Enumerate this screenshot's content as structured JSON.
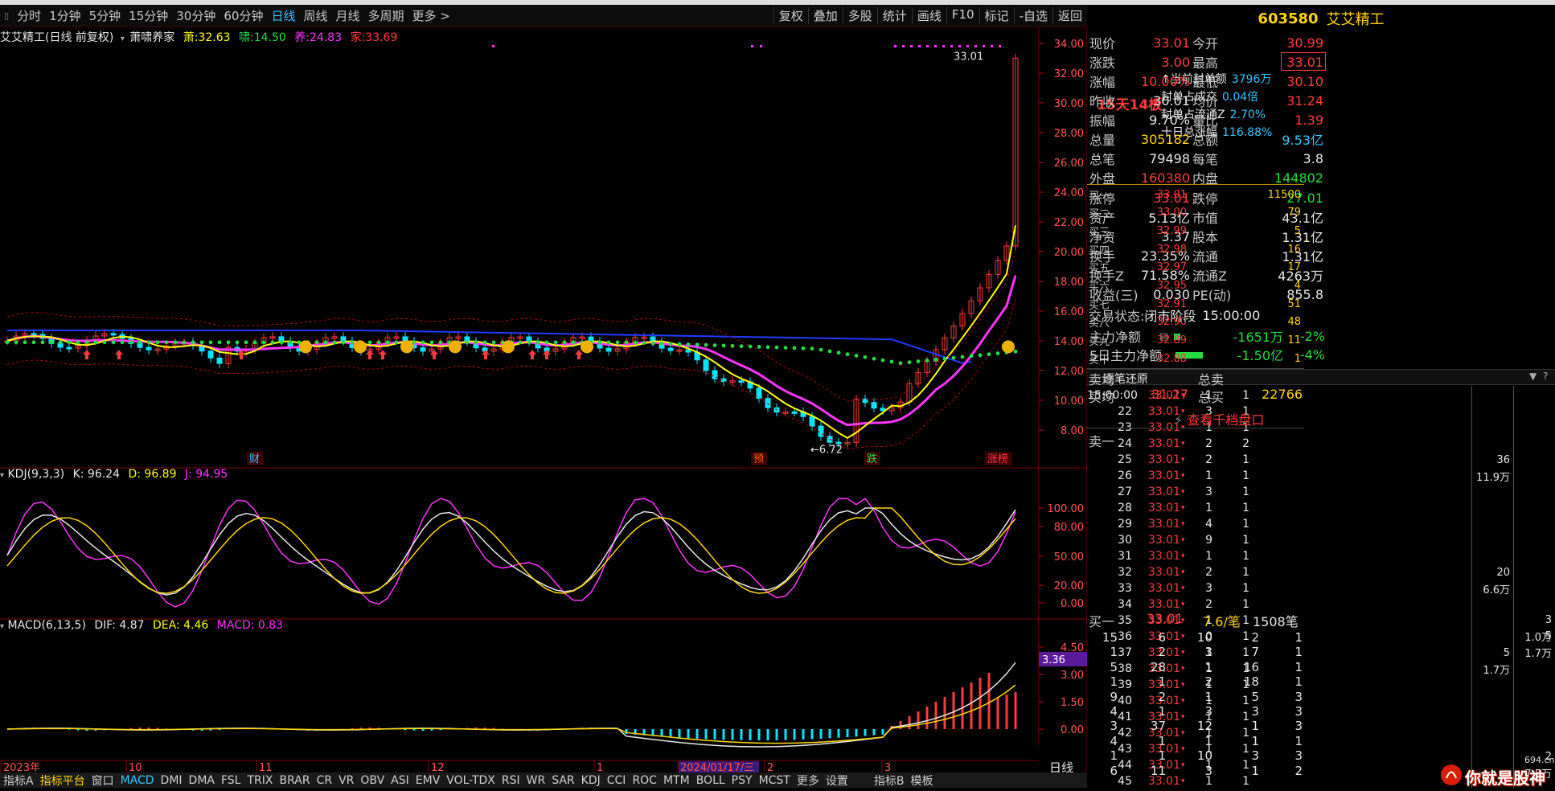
{
  "toolbar": {
    "periods": [
      "分时",
      "1分钟",
      "5分钟",
      "15分钟",
      "30分钟",
      "60分钟",
      "日线",
      "周线",
      "月线",
      "多周期",
      "更多 >"
    ],
    "active": "日线",
    "right": [
      "复权",
      "叠加",
      "多股",
      "统计",
      "画线",
      "F10",
      "标记",
      "-自选",
      "返回"
    ]
  },
  "chart": {
    "title": "艾艾精工(日线 前复权)",
    "indicator": "萧啸养家",
    "line1_label": "萧:",
    "line1_value": "32.63",
    "line2_label": "啸:",
    "line2_value": "14.50",
    "line3_label": "养:",
    "line3_value": "24.83",
    "line4_label": "家:",
    "line4_value": "33.69",
    "price_ticks": [
      "34.00",
      "32.00",
      "30.00",
      "28.00",
      "26.00",
      "24.00",
      "22.00",
      "20.00",
      "18.00",
      "16.00",
      "14.00",
      "12.00",
      "10.00",
      "8.00"
    ],
    "high_label": "33.01",
    "low_label": "6.72",
    "markers": [
      "财",
      "预",
      "跌",
      "涨榜"
    ],
    "kdj_title": "KDJ(9,3,3)",
    "kdj_k": "K: 96.24",
    "kdj_d": "D: 96.89",
    "kdj_j": "J: 94.95",
    "kdj_ticks": [
      "100.00",
      "80.00",
      "50.00",
      "20.00",
      "0.00"
    ],
    "macd_title": "MACD(6,13,5)",
    "macd_dif": "DIF: 4.87",
    "macd_dea": "DEA: 4.46",
    "macd_val": "MACD: 0.83",
    "macd_ticks": [
      "4.50",
      "3.00",
      "1.50",
      "0.00"
    ],
    "macd_cursor": "3.36",
    "date_labels": [
      "2023年",
      "10",
      "11",
      "12",
      "1",
      "2024/01/17/三",
      "2",
      "3"
    ],
    "period_label": "日线",
    "seal_info": {
      "streak": "15天14板",
      "rows": [
        {
          "k": "↑当前封单额",
          "v": "3796万"
        },
        {
          "k": "封单占成交",
          "v": "0.04倍"
        },
        {
          "k": "封单占流通Z",
          "v": "2.70%"
        },
        {
          "k": "十日总涨幅",
          "v": "116.88%"
        }
      ]
    }
  },
  "tabs": [
    "指标A",
    "指标平台",
    "窗口",
    "MACD",
    "DMI",
    "DMA",
    "FSL",
    "TRIX",
    "BRAR",
    "CR",
    "VR",
    "OBV",
    "ASI",
    "EMV",
    "VOL-TDX",
    "RSI",
    "WR",
    "SAR",
    "KDJ",
    "CCI",
    "ROC",
    "MTM",
    "BOLL",
    "PSY",
    "MCST",
    "更多",
    "设置",
    "指标B",
    "模板"
  ],
  "stock": {
    "code": "603580",
    "name": "艾艾精工"
  },
  "quote": [
    {
      "l1": "现价",
      "v1": "33.01",
      "c1": "red",
      "l2": "今开",
      "v2": "30.99",
      "c2": "red"
    },
    {
      "l1": "涨跌",
      "v1": "3.00",
      "c1": "red",
      "l2": "最高",
      "v2": "33.01",
      "c2": "red"
    },
    {
      "l1": "涨幅",
      "v1": "10.00%",
      "c1": "red",
      "l2": "最低",
      "v2": "30.10",
      "c2": "red"
    },
    {
      "l1": "昨收",
      "v1": "30.01",
      "c1": "wht",
      "l2": "均价",
      "v2": "31.24",
      "c2": "red"
    },
    {
      "l1": "振幅",
      "v1": "9.70%",
      "c1": "wht",
      "l2": "量比",
      "v2": "1.39",
      "c2": "red"
    },
    {
      "l1": "总量",
      "v1": "305182",
      "c1": "yel",
      "l2": "总额",
      "v2": "9.53亿",
      "c2": "cy"
    },
    {
      "l1": "总笔",
      "v1": "79498",
      "c1": "wht",
      "l2": "每笔",
      "v2": "3.8",
      "c2": "wht"
    },
    {
      "l1": "外盘",
      "v1": "160380",
      "c1": "red",
      "l2": "内盘",
      "v2": "144802",
      "c2": "grn"
    }
  ],
  "limits": [
    {
      "l1": "涨停",
      "v1": "33.01",
      "c1": "red",
      "l2": "跌停",
      "v2": "27.01",
      "c2": "grn"
    },
    {
      "l1": "资产",
      "v1": "5.13亿",
      "c1": "wht",
      "l2": "市值",
      "v2": "43.1亿",
      "c2": "wht"
    },
    {
      "l1": "净资",
      "v1": "3.37",
      "c1": "wht",
      "l2": "股本",
      "v2": "1.31亿",
      "c2": "wht"
    },
    {
      "l1": "换手",
      "v1": "23.35%",
      "c1": "wht",
      "l2": "流通",
      "v2": "1.31亿",
      "c2": "wht"
    },
    {
      "l1": "换手Z",
      "v1": "71.58%",
      "c1": "wht",
      "l2": "流通Z",
      "v2": "4263万",
      "c2": "wht"
    },
    {
      "l1": "收益(三)",
      "v1": "0.030",
      "c1": "wht",
      "l2": "PE(动)",
      "v2": "855.8",
      "c2": "wht"
    }
  ],
  "trade_status": {
    "label": "交易状态:",
    "phase": "闭市阶段",
    "time": "15:00:00"
  },
  "flows": [
    {
      "label": "主力净额",
      "value": "-1651万",
      "pct": "-2%"
    },
    {
      "label": "5日主力净额",
      "value": "-1.50亿",
      "pct": "-4%"
    }
  ],
  "bids": [
    {
      "l": "买一",
      "p": "33.01",
      "v": "11500"
    },
    {
      "l": "买二",
      "p": "33.00",
      "v": "79"
    },
    {
      "l": "买三",
      "p": "32.99",
      "v": "5"
    },
    {
      "l": "买四",
      "p": "32.98",
      "v": "16"
    },
    {
      "l": "买五",
      "p": "32.97",
      "v": "17"
    },
    {
      "l": "买六",
      "p": "32.95",
      "v": "4"
    },
    {
      "l": "买七",
      "p": "32.91",
      "v": "51"
    },
    {
      "l": "买八",
      "p": "32.90",
      "v": "48"
    },
    {
      "l": "买九",
      "p": "32.89",
      "v": "11"
    },
    {
      "l": "买十",
      "p": "32.88",
      "v": "1"
    }
  ],
  "avg": {
    "sell_avg": "卖均",
    "sell_total": "总卖",
    "buy_avg": "买均",
    "buy_avg_v": "31.27",
    "buy_total": "总买",
    "buy_total_v": "22766"
  },
  "more_depth": "查看千档盘口",
  "sell1": "卖一",
  "queue": {
    "label": "买一",
    "price": "33.01",
    "avg": "7.6/笔",
    "count": "1508笔",
    "rows": [
      [
        "15",
        "6",
        "10",
        "2",
        "1"
      ],
      [
        "1",
        "2",
        "3",
        "7",
        "1"
      ],
      [
        "5",
        "28",
        "1",
        "16",
        "1"
      ],
      [
        "1",
        "1",
        "2",
        "18",
        "1"
      ],
      [
        "9",
        "2",
        "1",
        "5",
        "3"
      ],
      [
        "4",
        "1",
        "3",
        "3",
        "3"
      ],
      [
        "3",
        "37",
        "12",
        "1",
        "3"
      ],
      [
        "4",
        "1",
        "1",
        "1",
        "1"
      ],
      [
        "1",
        "1",
        "10",
        "3",
        "3"
      ],
      [
        "6",
        "11",
        "3",
        "1",
        "2"
      ]
    ]
  },
  "ticks_title": "逐笔还原",
  "ticks": [
    {
      "t": "15:00:00",
      "p": "33.01",
      "a": "1",
      "b": "1"
    },
    {
      "t": "22",
      "p": "33.01",
      "a": "3",
      "b": "1"
    },
    {
      "t": "23",
      "p": "33.01",
      "a": "1",
      "b": "1"
    },
    {
      "t": "24",
      "p": "33.01",
      "a": "2",
      "b": "2"
    },
    {
      "t": "25",
      "p": "33.01",
      "a": "2",
      "b": "1"
    },
    {
      "t": "26",
      "p": "33.01",
      "a": "1",
      "b": "1"
    },
    {
      "t": "27",
      "p": "33.01",
      "a": "3",
      "b": "1"
    },
    {
      "t": "28",
      "p": "33.01",
      "a": "1",
      "b": "1"
    },
    {
      "t": "29",
      "p": "33.01",
      "a": "4",
      "b": "1"
    },
    {
      "t": "30",
      "p": "33.01",
      "a": "9",
      "b": "1"
    },
    {
      "t": "31",
      "p": "33.01",
      "a": "1",
      "b": "1"
    },
    {
      "t": "32",
      "p": "33.01",
      "a": "2",
      "b": "1"
    },
    {
      "t": "33",
      "p": "33.01",
      "a": "3",
      "b": "1"
    },
    {
      "t": "34",
      "p": "33.01",
      "a": "2",
      "b": "1"
    },
    {
      "t": "35",
      "p": "33.01",
      "a": "1",
      "b": "1"
    },
    {
      "t": "36",
      "p": "33.01",
      "a": "0",
      "b": "1"
    },
    {
      "t": "37",
      "p": "33.01",
      "a": "1",
      "b": "1"
    },
    {
      "t": "38",
      "p": "33.01",
      "a": "1",
      "b": "1"
    },
    {
      "t": "39",
      "p": "33.01",
      "a": "1",
      "b": "1"
    },
    {
      "t": "40",
      "p": "33.01",
      "a": "1",
      "b": "1"
    },
    {
      "t": "41",
      "p": "33.01",
      "a": "1",
      "b": "1"
    },
    {
      "t": "42",
      "p": "33.01",
      "a": "1",
      "b": "1"
    },
    {
      "t": "43",
      "p": "33.01",
      "a": "1",
      "b": "1"
    },
    {
      "t": "44",
      "p": "33.01",
      "a": "1",
      "b": "1"
    },
    {
      "t": "45",
      "p": "33.01",
      "a": "1",
      "b": "1"
    }
  ],
  "agg_col1": [
    {
      "v": "36",
      "s": "11.9万"
    },
    {
      "v": "20",
      "s": "6.6万"
    },
    {
      "v": "5",
      "s": "1.7万"
    }
  ],
  "agg_col2": [
    {
      "v": "3",
      "s": "1.0万"
    },
    {
      "v": "5",
      "s": "1.7万"
    },
    {
      "v": "2",
      "s": "7.5万"
    }
  ],
  "watermark": "你就是股神",
  "watermark_sub": "694.cn",
  "colors": {
    "up": "#ff3b3b",
    "down": "#00e5ff",
    "ma5": "#ffff00",
    "ma10": "#ff33ff",
    "ma60": "#1f3bff",
    "dots": "#22dd44"
  }
}
